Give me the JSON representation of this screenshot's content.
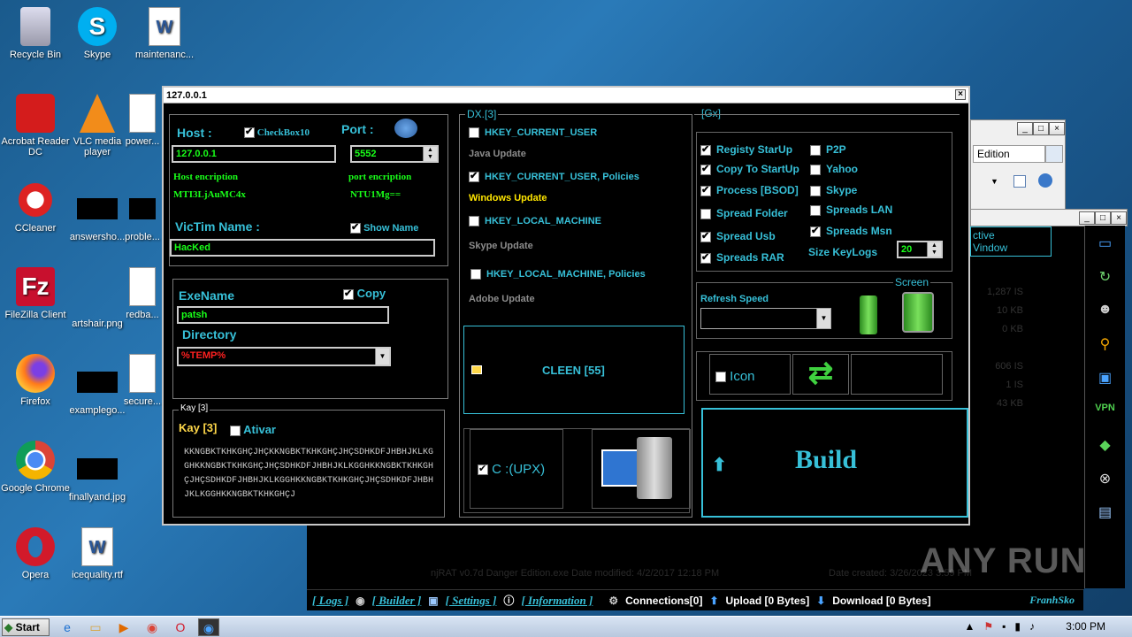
{
  "desktop_icons": [
    {
      "label": "Recycle Bin",
      "icon": "recycle-bin-icon"
    },
    {
      "label": "Skype",
      "icon": "skype-icon"
    },
    {
      "label": "maintenanc...",
      "icon": "word-doc-icon"
    },
    {
      "label": "Acrobat Reader DC",
      "icon": "acrobat-icon"
    },
    {
      "label": "VLC media player",
      "icon": "vlc-icon"
    },
    {
      "label": "power...",
      "icon": "word-doc-icon"
    },
    {
      "label": "CCleaner",
      "icon": "ccleaner-icon"
    },
    {
      "label": "answersho...",
      "icon": "image-thumb-icon"
    },
    {
      "label": "proble...",
      "icon": "image-thumb-icon"
    },
    {
      "label": "FileZilla Client",
      "icon": "filezilla-icon"
    },
    {
      "label": "artshair.png",
      "icon": "image-thumb-icon"
    },
    {
      "label": "redba...",
      "icon": "word-doc-icon"
    },
    {
      "label": "Firefox",
      "icon": "firefox-icon"
    },
    {
      "label": "examplego...",
      "icon": "image-thumb-icon"
    },
    {
      "label": "secure...",
      "icon": "word-doc-icon"
    },
    {
      "label": "Google Chrome",
      "icon": "chrome-icon"
    },
    {
      "label": "finallyand.jpg",
      "icon": "image-thumb-icon"
    },
    {
      "label": "Opera",
      "icon": "opera-icon"
    },
    {
      "label": "icequality.rtf",
      "icon": "word-doc-icon"
    }
  ],
  "bg_window": {
    "search_text": "Edition",
    "list_header_1": "ctive",
    "list_header_2": "Vindow",
    "faded_values": [
      "1,287 IS",
      "10 KB",
      "0 KB",
      "606 IS",
      "1 IS",
      "43 KB"
    ]
  },
  "rat_status": {
    "logs": "[ Logs ]",
    "builder": "[ Builder ]",
    "settings": "[ Settings ]",
    "information": "[ Information ]",
    "connections": "Connections[0]",
    "upload": "Upload [0 Bytes]",
    "download": "Download [0 Bytes]",
    "author": "FranhSko",
    "faded_file": "njRAT v0.7d Danger Edition.exe Date modified: 4/2/2017 12:18 PM",
    "faded_date": "Date created: 3/26/2023 3:59 PM"
  },
  "side_icons": [
    "monitor-icon",
    "refresh-icon",
    "user-icon",
    "location-icon",
    "screen-icon",
    "VPN",
    "shield-icon",
    "compass-icon",
    "window-icon"
  ],
  "dialog": {
    "title": "127.0.0.1",
    "host_label": "Host :",
    "checkbox10": "CheckBox10",
    "port_label": "Port :",
    "host_value": "127.0.0.1",
    "port_value": "5552",
    "host_enc_label": "Host encription",
    "host_enc_value": "MTI3LjAuMC4x",
    "port_enc_label": "port encription",
    "port_enc_value": "NTU1Mg==",
    "victim_label": "VicTim Name :",
    "show_name": "Show Name",
    "victim_value": "HacKed",
    "exe_label": "ExeName",
    "copy_label": "Copy",
    "exe_value": "patsh",
    "dir_label": "Directory",
    "dir_value": "%TEMP%",
    "kay_group": "Kay [3]",
    "kay_label": "Kay [3]",
    "ativar": "Ativar",
    "key_text": "KKNGBKTKHKGHÇJHÇKKNGBKTKHKGHÇJHÇSDHKDFJHBHJKLKGGHKKNGBKTKHKGHÇJHÇSDHKDFJHBHJKLKGGHKKNGBKTKHKGHÇJHÇSDHKDFJHBHJKLKGGHKKNGBKTKHKGHÇJHÇSDHKDFJHBHJKLKGGHKKNGBKTKHKGHÇJ",
    "dx_group": "DX.[3]",
    "reg1": "HKEY_CURRENT_USER",
    "reg1_sub": "Java Update",
    "reg2": "HKEY_CURRENT_USER, Policies",
    "reg2_sub": "Windows Update",
    "reg3": "HKEY_LOCAL_MACHINE",
    "reg3_sub": "Skype Update",
    "reg4": "HKEY_LOCAL_MACHINE, Policies",
    "reg4_sub": "Adobe Update",
    "cleen": "CLEEN [55]",
    "upx": "C :(UPX)",
    "gx_group": "[Gx]",
    "opt_registry": "Registy StarUp",
    "opt_copy_startup": "Copy To StartUp",
    "opt_process": "Process [BSOD]",
    "opt_spread_folder": "Spread Folder",
    "opt_spread_usb": "Spread Usb",
    "opt_spreads_rar": "Spreads RAR",
    "opt_p2p": "P2P",
    "opt_yahoo": "Yahoo",
    "opt_skype": "Skype",
    "opt_spreads_lan": "Spreads LAN",
    "opt_spreads_msn": "Spreads Msn",
    "size_keylogs_label": "Size KeyLogs",
    "size_keylogs_value": "20",
    "refresh_label": "Refresh Speed",
    "screen_label": "Screen",
    "icon_label": "Icon",
    "build": "Build"
  },
  "taskbar": {
    "start": "Start",
    "clock": "3:00 PM"
  },
  "watermark": "ANY RUN",
  "colors": {
    "accent_cyan": "#37c0d8",
    "text_green": "#19ff19",
    "key_yellow": "#ffd84a",
    "dir_red": "#ff2020"
  }
}
